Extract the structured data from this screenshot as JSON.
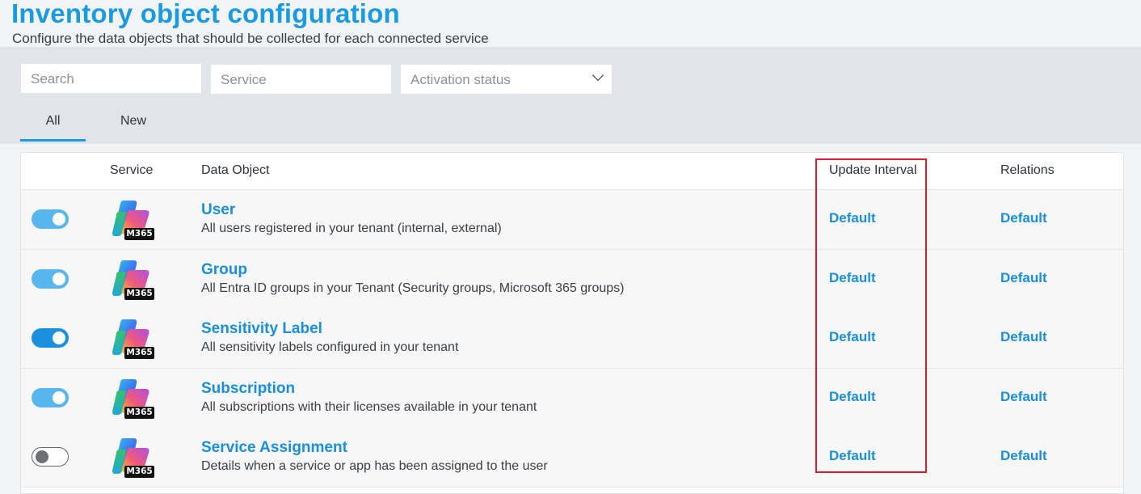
{
  "header": {
    "title": "Inventory object configuration",
    "subtitle": "Configure the data objects that should be collected for each connected service"
  },
  "filters": {
    "search_placeholder": "Search",
    "service_placeholder": "Service",
    "status_placeholder": "Activation status"
  },
  "tabs": [
    {
      "label": "All",
      "active": true
    },
    {
      "label": "New",
      "active": false
    }
  ],
  "table": {
    "columns": {
      "service": "Service",
      "data_object": "Data Object",
      "update_interval": "Update Interval",
      "relations": "Relations"
    },
    "rows": [
      {
        "active": true,
        "service_badge": "M365",
        "title": "User",
        "description": "All users registered in your tenant (internal, external)",
        "update_interval": "Default",
        "relations": "Default"
      },
      {
        "active": true,
        "service_badge": "M365",
        "title": "Group",
        "description": "All Entra ID groups in your Tenant (Security groups, Microsoft 365 groups)",
        "update_interval": "Default",
        "relations": "Default"
      },
      {
        "active": true,
        "service_badge": "M365",
        "title": "Sensitivity Label",
        "description": "All sensitivity labels configured in your tenant",
        "update_interval": "Default",
        "relations": "Default"
      },
      {
        "active": true,
        "service_badge": "M365",
        "title": "Subscription",
        "description": "All subscriptions with their licenses available in your tenant",
        "update_interval": "Default",
        "relations": "Default"
      },
      {
        "active": false,
        "service_badge": "M365",
        "title": "Service Assignment",
        "description": "Details when a service or app has been assigned to the user",
        "update_interval": "Default",
        "relations": "Default"
      }
    ]
  },
  "colors": {
    "accent": "#1a9be0",
    "link": "#1a8fd8",
    "highlight": "#e01b2b",
    "toggle_on": "#58b6ee"
  }
}
